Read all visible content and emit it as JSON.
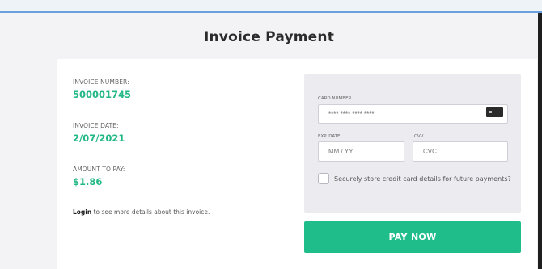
{
  "page": {
    "title": "Invoice Payment"
  },
  "invoice": {
    "number_label": "INVOICE NUMBER:",
    "number": "500001745",
    "date_label": "INVOICE DATE:",
    "date": "2/07/2021",
    "amount_label": "AMOUNT TO PAY:",
    "amount": "$1.86",
    "login_link": "Login",
    "login_text": " to see more details about this invoice."
  },
  "payment": {
    "card_number_label": "CARD NUMBER",
    "card_number_placeholder": "**** **** **** ****",
    "card_brand_icon": "credit-card-icon",
    "exp_label": "EXP. DATE",
    "exp_placeholder": "MM / YY",
    "cvv_label": "CVV",
    "cvv_placeholder": "CVC",
    "store_label": "Securely store credit card details for future payments?",
    "store_checked": false,
    "pay_button": "PAY NOW"
  },
  "colors": {
    "accent": "#1fbd8a",
    "value_green": "#22b786",
    "panel_bg": "#ebebf0",
    "top_border": "#6aa0dd"
  }
}
